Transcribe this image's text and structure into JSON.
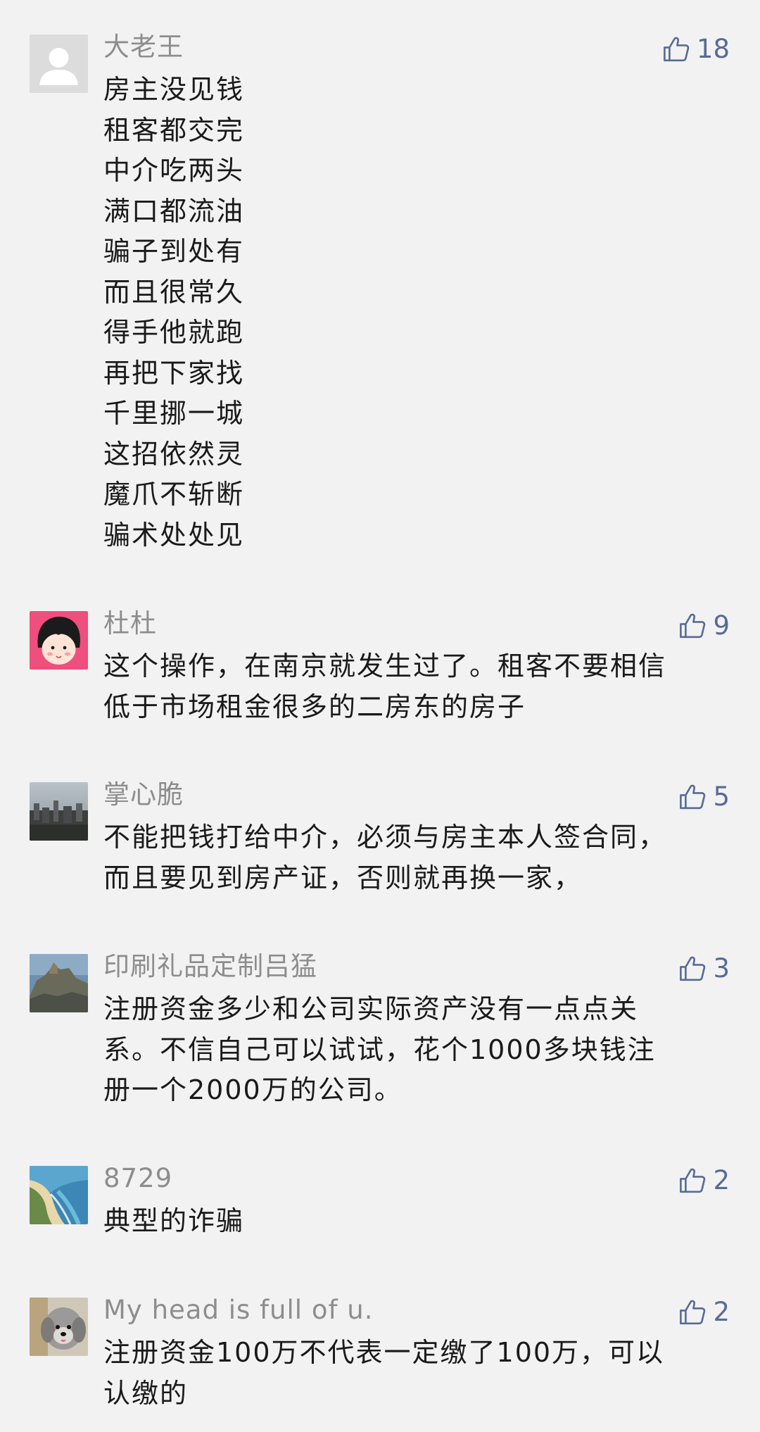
{
  "comments": [
    {
      "user": "大老王",
      "avatar": "default-user-avatar",
      "likes": "18",
      "lines": [
        "房主没见钱",
        "租客都交完",
        "中介吃两头",
        "满口都流油",
        "骗子到处有",
        "而且很常久",
        "得手他就跑",
        "再把下家找",
        "千里挪一城",
        "这招依然灵",
        "魔爪不斩断",
        "骗术处处见"
      ]
    },
    {
      "user": "杜杜",
      "avatar": "cartoon-girl-avatar",
      "likes": "9",
      "lines": [
        "这个操作，在南京就发生过了。租客不要相信",
        "低于市场租金很多的二房东的房子"
      ]
    },
    {
      "user": "掌心脆",
      "avatar": "city-photo-avatar",
      "likes": "5",
      "lines": [
        "不能把钱打给中介，必须与房主本人签合同，",
        "而且要见到房产证，否则就再换一家，"
      ]
    },
    {
      "user": "印刷礼品定制吕猛",
      "avatar": "landscape-photo-avatar",
      "likes": "3",
      "lines": [
        "注册资金多少和公司实际资产没有一点点关",
        "系。不信自己可以试试，花个1000多块钱注",
        "册一个2000万的公司。"
      ]
    },
    {
      "user": "8729",
      "avatar": "beach-photo-avatar",
      "likes": "2",
      "lines": [
        "典型的诈骗"
      ]
    },
    {
      "user": "My head is full of u.",
      "avatar": "dog-photo-avatar",
      "likes": "2",
      "lines": [
        "注册资金100万不代表一定缴了100万，可以",
        "认缴的"
      ]
    }
  ],
  "colors": {
    "background": "#f2f2f3",
    "name": "#8d8d8d",
    "content": "#1a1a1a",
    "like": "#576b95"
  },
  "icons": {
    "like": "thumbs-up-icon"
  }
}
